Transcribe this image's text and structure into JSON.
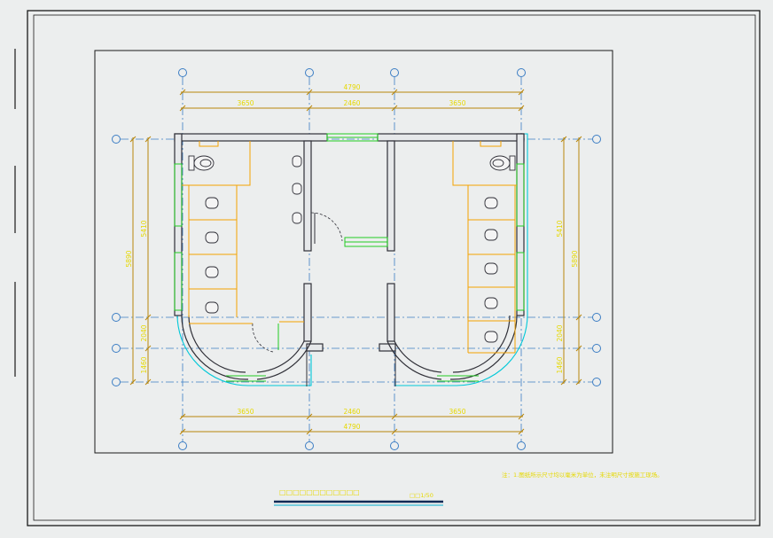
{
  "drawing": {
    "dimensions": {
      "overall_top": "4790",
      "overall_bottom": "4790",
      "seg_top": [
        "3650",
        "2460",
        "3650"
      ],
      "seg_bottom": [
        "3650",
        "2460",
        "3650"
      ],
      "left_outer": "5890",
      "left_inner": "5410",
      "left_small": [
        "2040",
        "1460"
      ],
      "right_outer": "5890",
      "right_inner": "5410",
      "right_small": [
        "2040",
        "1460"
      ]
    },
    "title_block": {
      "title": "□□□□□□□□□□□□",
      "scale": "□□1/50"
    },
    "note": "注：1.图纸所示尺寸均以毫米为单位，未注明尺寸按施工现场。"
  },
  "colors": {
    "background": "#eceeee",
    "line": "#1a1a1a",
    "wall": "#303038",
    "dimension": "#b8860b",
    "dim_text": "#e6d800",
    "axis": "#3b7dc4",
    "partition": "#f5a300",
    "window": "#22cc22",
    "slab_edge": "#00c8d8"
  }
}
